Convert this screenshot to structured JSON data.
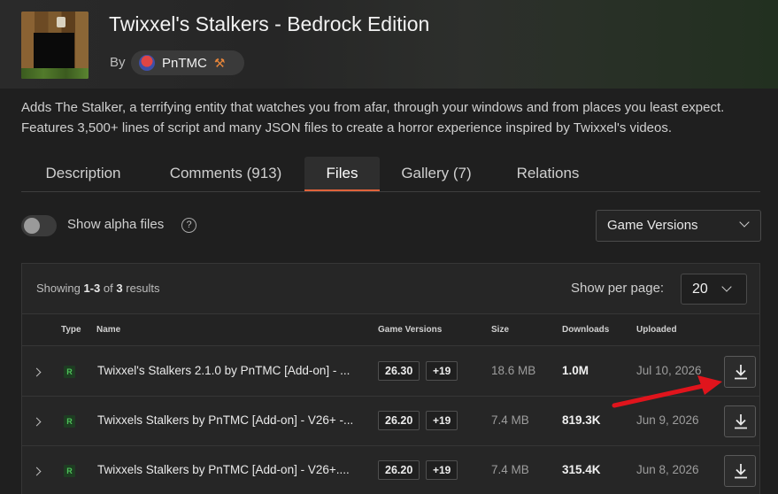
{
  "project": {
    "title": "Twixxel's Stalkers - Bedrock Edition",
    "by_label": "By",
    "author": "PnTMC",
    "description": "Adds The Stalker, a terrifying entity that watches you from afar, through your windows and from places you least expect. Features 3,500+ lines of script and many JSON files to create a horror experience inspired by Twixxel's videos."
  },
  "tabs": [
    {
      "label": "Description",
      "active": false
    },
    {
      "label": "Comments (913)",
      "active": false
    },
    {
      "label": "Files",
      "active": true
    },
    {
      "label": "Gallery (7)",
      "active": false
    },
    {
      "label": "Relations",
      "active": false
    }
  ],
  "filters": {
    "alpha_toggle_label": "Show alpha files",
    "alpha_toggle_on": false,
    "help_glyph": "?",
    "game_versions_label": "Game Versions"
  },
  "results": {
    "showing_prefix": "Showing",
    "range": "1-3",
    "of_word": "of",
    "total": "3",
    "suffix": "results",
    "per_page_label": "Show per page:",
    "per_page_value": "20"
  },
  "table": {
    "headers": {
      "type": "Type",
      "name": "Name",
      "game_versions": "Game Versions",
      "size": "Size",
      "downloads": "Downloads",
      "uploaded": "Uploaded"
    },
    "rows": [
      {
        "type": "R",
        "name": "Twixxel's Stalkers 2.1.0 by PnTMC [Add-on] - ...",
        "version": "26.30",
        "more_versions": "+19",
        "size": "18.6 MB",
        "downloads": "1.0M",
        "uploaded": "Jul 10, 2026"
      },
      {
        "type": "R",
        "name": "Twixxels Stalkers by PnTMC [Add-on] - V26+ -...",
        "version": "26.20",
        "more_versions": "+19",
        "size": "7.4 MB",
        "downloads": "819.3K",
        "uploaded": "Jun 9, 2026"
      },
      {
        "type": "R",
        "name": "Twixxels Stalkers by PnTMC [Add-on] - V26+....",
        "version": "26.20",
        "more_versions": "+19",
        "size": "7.4 MB",
        "downloads": "315.4K",
        "uploaded": "Jun 8, 2026"
      }
    ]
  },
  "icons": {
    "author_badge": "pickaxe-hammer-icon",
    "download": "download-icon",
    "expand": "chevron-right-icon",
    "annotation": "red-arrow-icon"
  },
  "colors": {
    "accent": "#e0633b",
    "release_badge": "#4ec25a",
    "annotation_arrow": "#e0141c"
  }
}
